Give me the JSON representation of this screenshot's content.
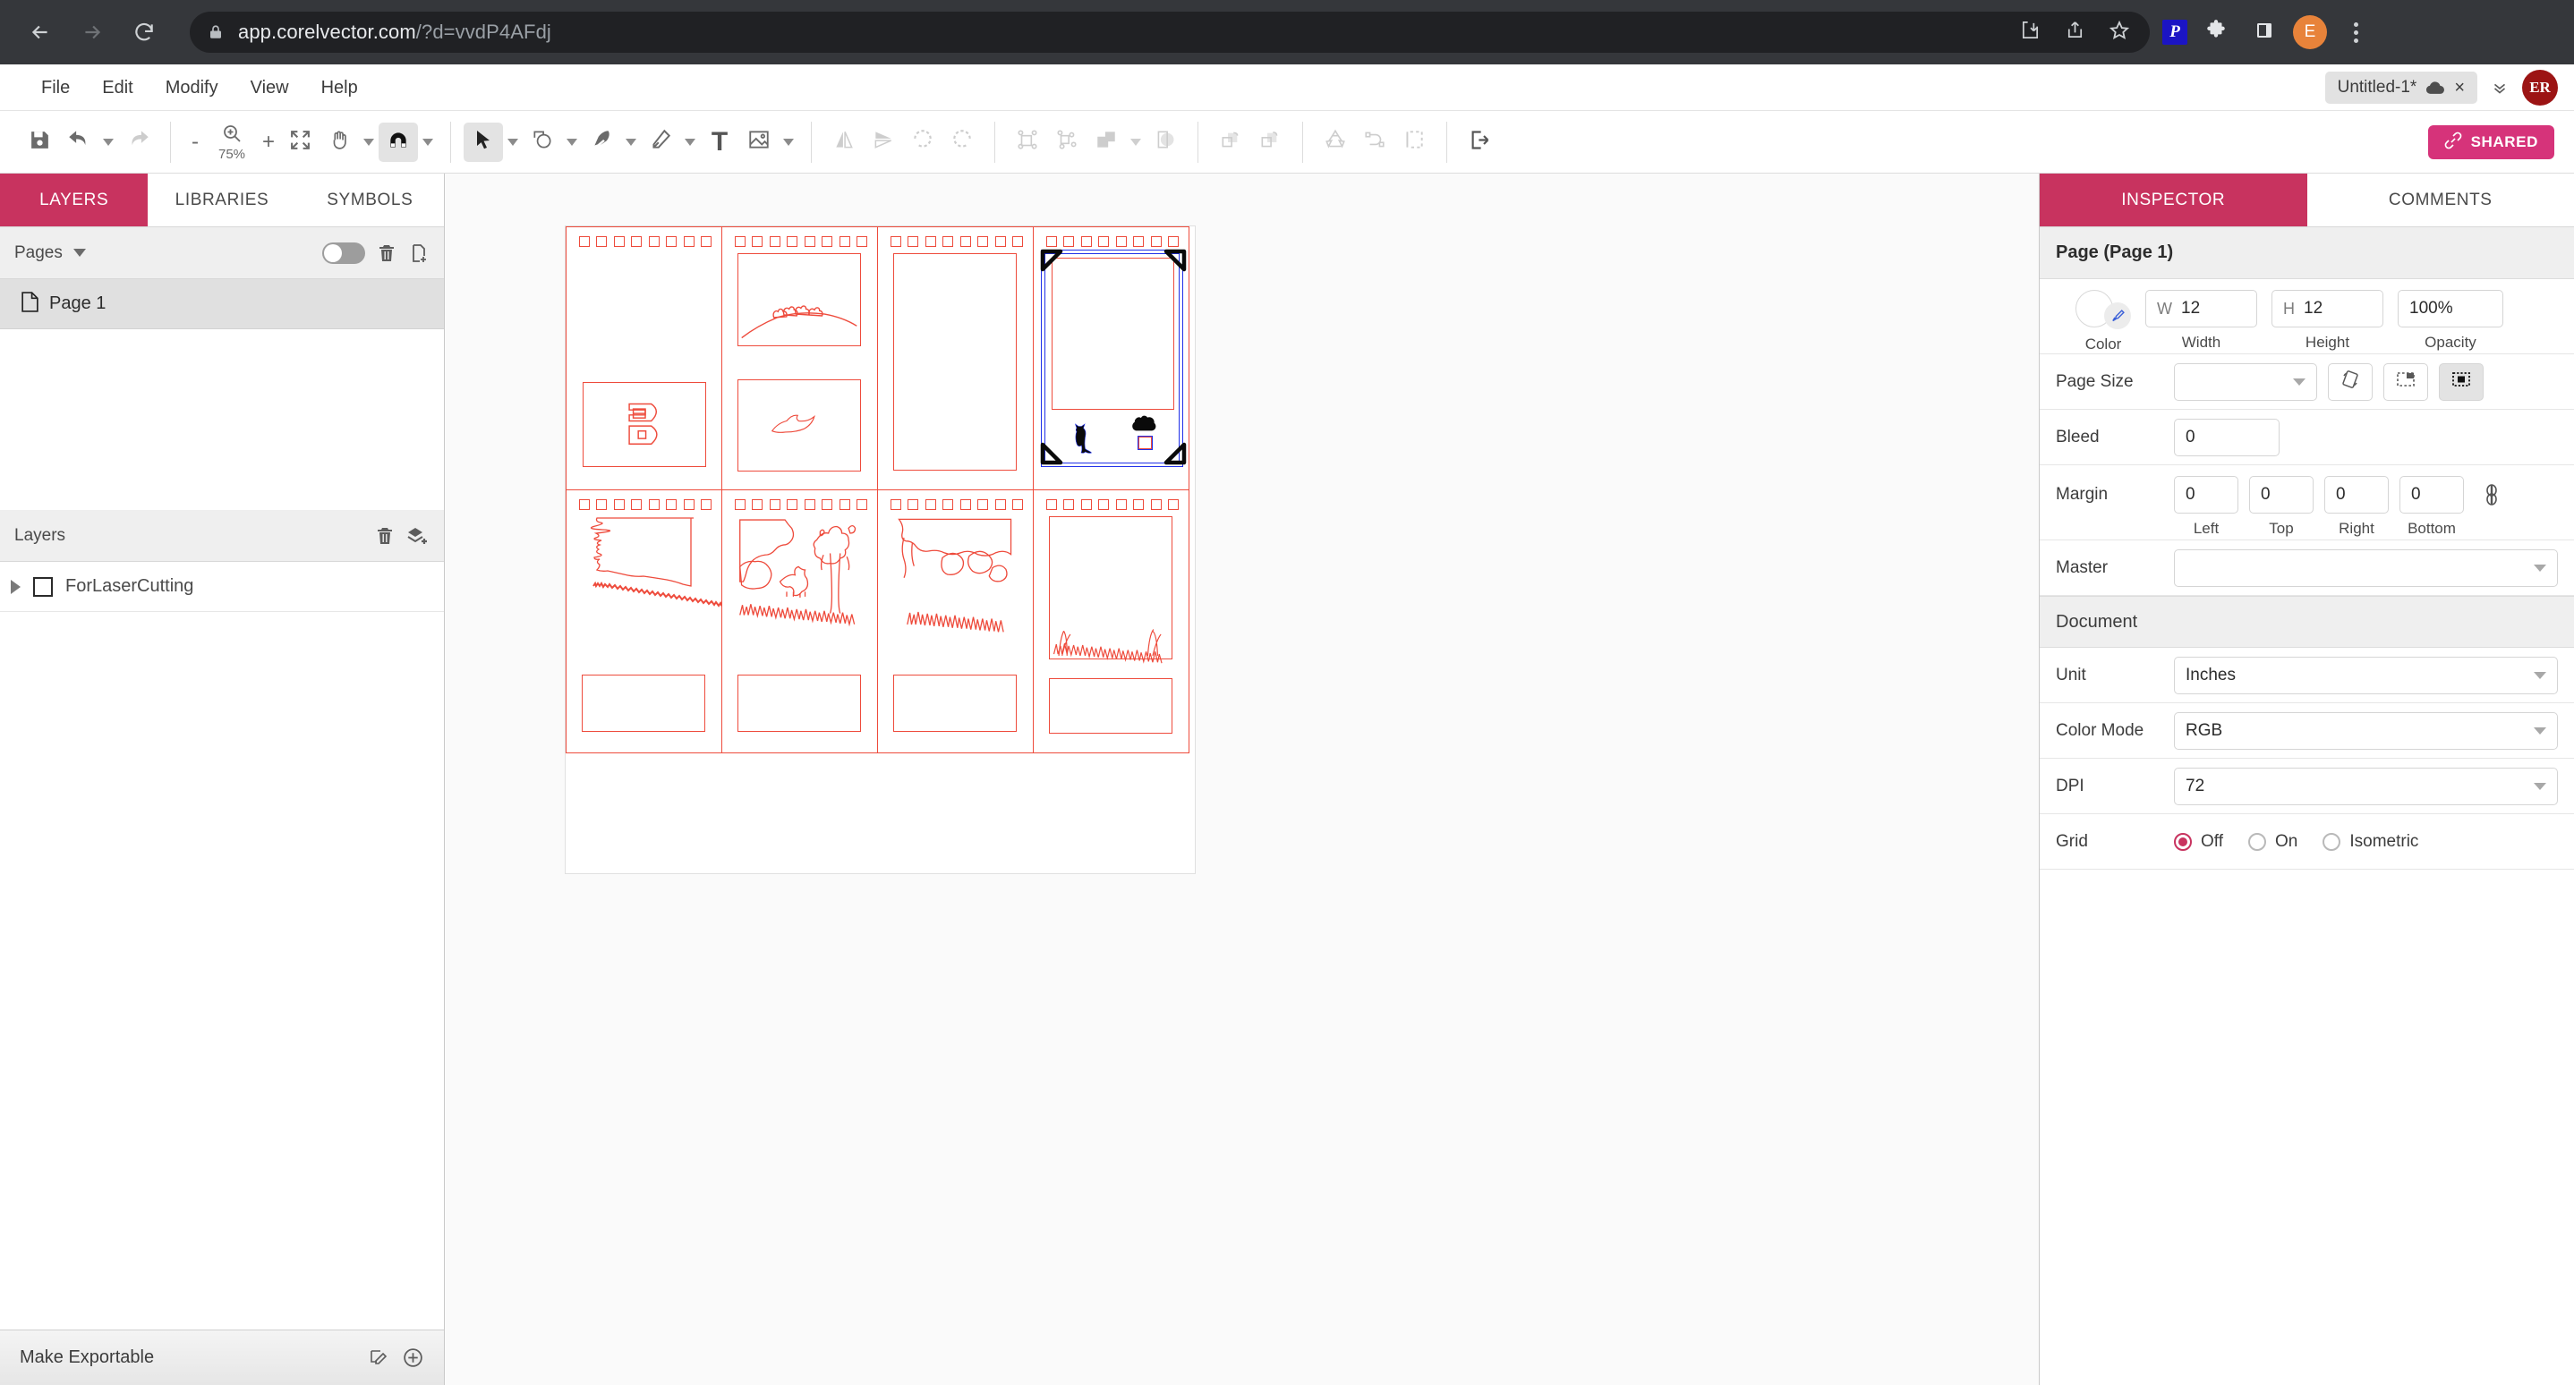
{
  "browser": {
    "url_host": "app.corelvector.com",
    "url_path": "/?d=vvdP4AFdj",
    "back_icon": "back-arrow-icon",
    "forward_icon": "forward-arrow-icon",
    "reload_icon": "reload-icon",
    "lock_icon": "lock-icon",
    "download_icon": "download-icon",
    "share_icon": "share-icon",
    "bookmark_icon": "star-icon",
    "paypal_label": "P",
    "extensions_icon": "puzzle-piece-icon",
    "sidepanel_icon": "side-panel-icon",
    "profile_initial": "E",
    "menu_icon": "three-dot-menu-icon"
  },
  "menubar": {
    "items": [
      "File",
      "Edit",
      "Modify",
      "View",
      "Help"
    ],
    "doc_tab_title": "Untitled-1*",
    "doc_tab_cloud_icon": "cloud-icon",
    "doc_tab_close": "×",
    "tab_overflow_icon": "double-chevron-down-icon",
    "user_initials": "ER"
  },
  "toolbar": {
    "save_icon": "save-floppy-icon",
    "undo_icon": "undo-icon",
    "redo_icon": "redo-icon",
    "zoom_out_label": "-",
    "zoom_in_label": "+",
    "zoom_level": "75%",
    "zoom_icon": "zoom-in-magnifier-icon",
    "fit_icon": "fit-to-screen-icon",
    "pan_icon": "hand-pan-icon",
    "snap_icon": "magnet-snap-icon",
    "select_icon": "arrow-select-icon",
    "shape_icon": "shape-rect-circle-icon",
    "pen_icon": "pen-nib-icon",
    "pencil_icon": "pencil-icon",
    "text_icon": "text-tool-icon",
    "image_icon": "image-placeholder-icon",
    "flip_h_icon": "flip-horizontal-icon",
    "flip_v_icon": "flip-vertical-icon",
    "rotate_ccw_icon": "rotate-counterclockwise-icon",
    "rotate_cw_icon": "rotate-clockwise-icon",
    "group_icon": "group-objects-icon",
    "ungroup_icon": "ungroup-objects-icon",
    "arrange_icon": "arrange-order-icon",
    "boolean_icon": "boolean-ops-icon",
    "duplicate_fwd_icon": "duplicate-forward-icon",
    "duplicate_back_icon": "duplicate-back-icon",
    "recycle_icon": "recycle-paths-icon",
    "node_path_icon": "node-path-icon",
    "marquee_icon": "marquee-select-icon",
    "export_icon": "export-logout-icon",
    "shared_label": "SHARED",
    "shared_icon": "link-chain-icon",
    "shared_color": "#d6337a"
  },
  "left_panel": {
    "tabs": [
      {
        "label": "LAYERS",
        "active": true
      },
      {
        "label": "LIBRARIES",
        "active": false
      },
      {
        "label": "SYMBOLS",
        "active": false
      }
    ],
    "pages_section": {
      "title": "Pages",
      "caret_icon": "chevron-down-icon",
      "toggle_icon": "visibility-toggle",
      "delete_icon": "trash-icon",
      "add_icon": "add-page-icon",
      "items": [
        {
          "label": "Page 1",
          "icon": "page-file-icon",
          "selected": true
        }
      ]
    },
    "layers_section": {
      "title": "Layers",
      "delete_icon": "trash-icon",
      "add_icon": "add-layer-icon",
      "items": [
        {
          "label": "ForLaserCutting",
          "expand_icon": "triangle-right-icon",
          "checkbox": false
        }
      ]
    },
    "footer": {
      "label": "Make Exportable",
      "edit_icon": "edit-export-icon",
      "add_icon": "plus-circle-icon"
    }
  },
  "inspector": {
    "tabs": [
      {
        "label": "INSPECTOR",
        "active": true
      },
      {
        "label": "COMMENTS",
        "active": false
      }
    ],
    "header": "Page (Page 1)",
    "color": {
      "label": "Color",
      "icon": "eyedropper-icon"
    },
    "width": {
      "prefix": "W",
      "value": "12",
      "label": "Width"
    },
    "height": {
      "prefix": "H",
      "value": "12",
      "label": "Height"
    },
    "opacity": {
      "value": "100%",
      "label": "Opacity"
    },
    "page_size": {
      "label": "Page Size",
      "value": "",
      "orientation_icon": "rotate-orientation-icon",
      "bleed_box_icon": "bleed-box-icon",
      "trim_box_icon": "trim-box-icon"
    },
    "bleed": {
      "label": "Bleed",
      "value": "0"
    },
    "margin": {
      "label": "Margin",
      "left": {
        "value": "0",
        "caption": "Left"
      },
      "top": {
        "value": "0",
        "caption": "Top"
      },
      "right": {
        "value": "0",
        "caption": "Right"
      },
      "bottom": {
        "value": "0",
        "caption": "Bottom"
      },
      "link_icon": "link-margins-icon"
    },
    "master": {
      "label": "Master",
      "value": ""
    },
    "document_header": "Document",
    "unit": {
      "label": "Unit",
      "value": "Inches"
    },
    "color_mode": {
      "label": "Color Mode",
      "value": "RGB"
    },
    "dpi": {
      "label": "DPI",
      "value": "72"
    },
    "grid": {
      "label": "Grid",
      "options": [
        {
          "label": "Off",
          "selected": true
        },
        {
          "label": "On",
          "selected": false
        },
        {
          "label": "Isometric",
          "selected": false
        }
      ]
    },
    "accent_color": "#c8335f"
  },
  "canvas": {
    "stroke_color": "#ee4b3c",
    "selection_color": "#2030e8",
    "handle_color": "#111111",
    "cell_count": 8,
    "perforations_per_cell": 8,
    "selected_cell_index": 3,
    "cells": [
      {
        "index": 0,
        "artwork": "logo-letter-b-frame"
      },
      {
        "index": 1,
        "artwork": "deer-hill-and-fox-frames"
      },
      {
        "index": 2,
        "artwork": "empty-tall-frame"
      },
      {
        "index": 3,
        "artwork": "cat-and-bush-silhouettes",
        "selected": true
      },
      {
        "index": 4,
        "artwork": "ridge-landscape"
      },
      {
        "index": 5,
        "artwork": "tree-fox-grass-scene"
      },
      {
        "index": 6,
        "artwork": "forest-grass-scene"
      },
      {
        "index": 7,
        "artwork": "reeds-grass-scene"
      }
    ]
  }
}
